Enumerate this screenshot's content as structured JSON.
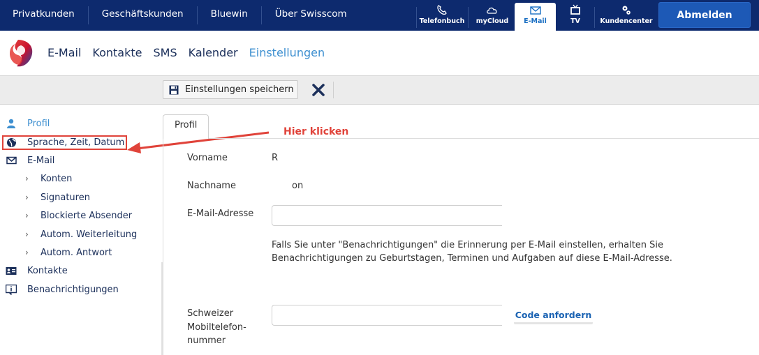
{
  "topnav": {
    "items": [
      "Privatkunden",
      "Geschäftskunden",
      "Bluewin",
      "Über Swisscom"
    ]
  },
  "services": [
    {
      "label": "Telefonbuch",
      "icon": "phone-icon"
    },
    {
      "label": "myCloud",
      "icon": "cloud-icon"
    },
    {
      "label": "E-Mail",
      "icon": "mail-icon",
      "active": true
    },
    {
      "label": "TV",
      "icon": "tv-icon"
    },
    {
      "label": "Kundencenter",
      "icon": "gears-icon"
    }
  ],
  "logout_label": "Abmelden",
  "appnav": {
    "items": [
      "E-Mail",
      "Kontakte",
      "SMS",
      "Kalender",
      "Einstellungen"
    ],
    "active": "Einstellungen"
  },
  "toolbar": {
    "save_label": "Einstellungen speichern"
  },
  "sidebar": {
    "profile": "Profil",
    "language": "Sprache, Zeit, Datum",
    "email": "E-Mail",
    "email_sub": [
      "Konten",
      "Signaturen",
      "Blockierte Absender",
      "Autom. Weiterleitung",
      "Autom. Antwort"
    ],
    "contacts": "Kontakte",
    "notifications": "Benachrichtigungen"
  },
  "annotation": {
    "text": "Hier klicken"
  },
  "content": {
    "tab_label": "Profil",
    "firstname_label": "Vorname",
    "firstname_value": "R",
    "lastname_label": "Nachname",
    "lastname_value": "on",
    "email_label": "E-Mail-Adresse",
    "email_value": "",
    "hint": "Falls Sie unter \"Benachrichtigungen\" die Erinnerung per E-Mail einstellen, erhalten Sie Benachrichtigungen zu Geburtstagen, Terminen und Aufgaben auf diese E-Mail-Adresse.",
    "mobile_label": "Schweizer Mobiltelefon-nummer",
    "mobile_value": "",
    "code_button": "Code anfordern"
  },
  "colors": {
    "topbar": "#0d2a6e",
    "accent": "#3d8fd0",
    "annotation": "#e0433a",
    "logout": "#1d59b6"
  }
}
